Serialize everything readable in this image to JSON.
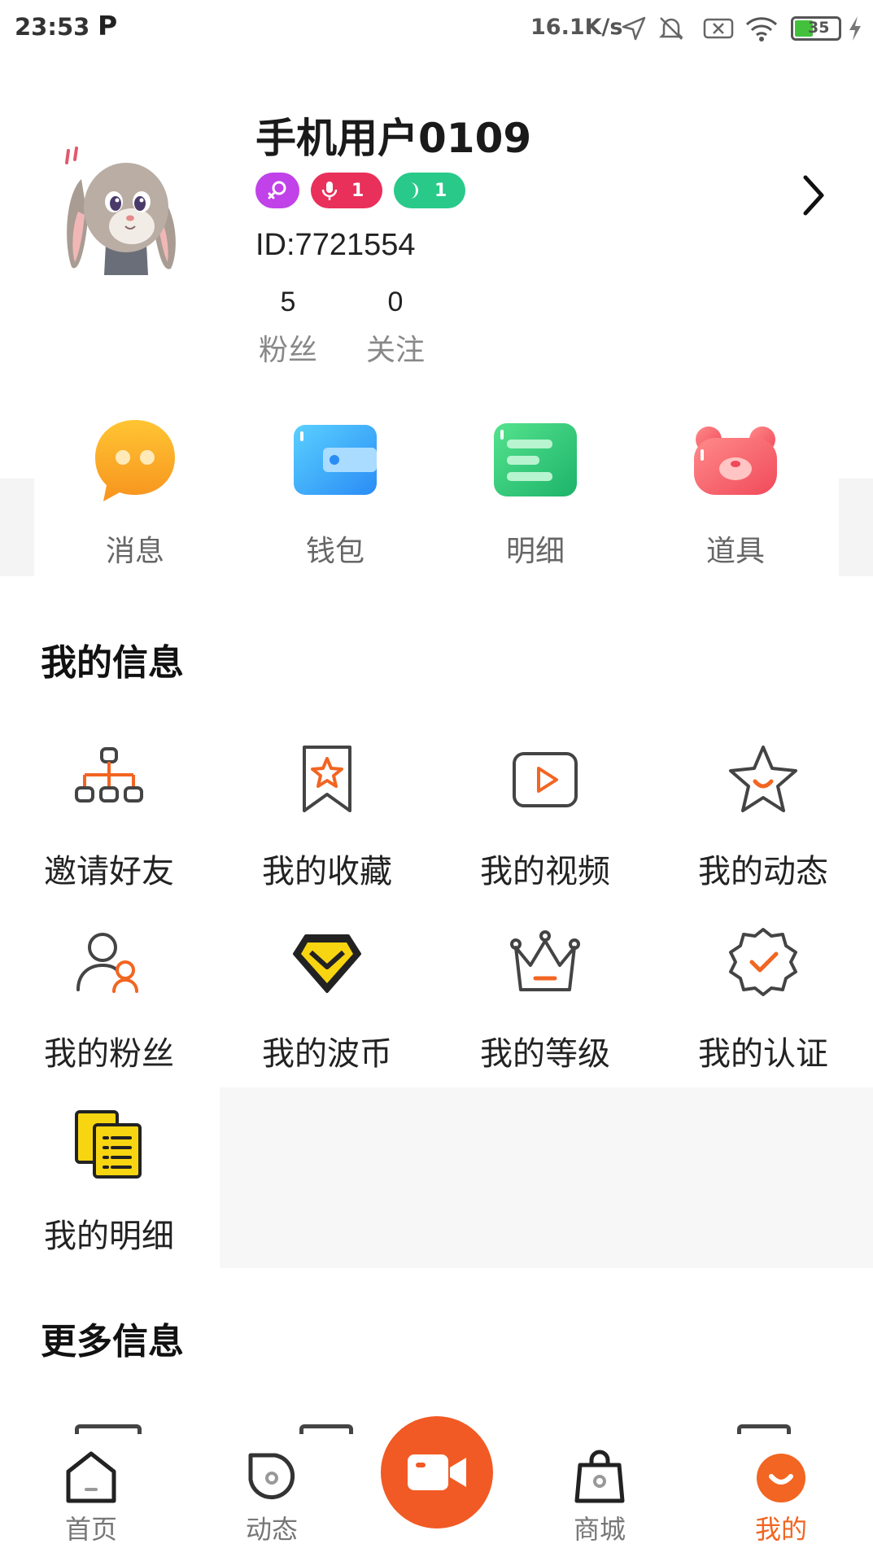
{
  "status_bar": {
    "time": "23:53",
    "app_icon": "P",
    "net_speed": "16.1K/s",
    "battery": "35",
    "icons": [
      "location-arrow-icon",
      "mute-bell-icon",
      "sim-x-icon",
      "wifi-icon",
      "battery-icon",
      "charging-icon"
    ]
  },
  "profile": {
    "username": "手机用户0109",
    "badges": [
      {
        "icon": "female-icon",
        "count": ""
      },
      {
        "icon": "mic-icon",
        "count": "1"
      },
      {
        "icon": "moon-icon",
        "count": "1"
      }
    ],
    "id_text": "ID:7721554",
    "fans_value": "5",
    "fans_label": "粉丝",
    "follow_value": "0",
    "follow_label": "关注"
  },
  "quick_actions": [
    {
      "label": "消息",
      "icon": "chat-bubble-icon"
    },
    {
      "label": "钱包",
      "icon": "wallet-icon"
    },
    {
      "label": "明细",
      "icon": "details-icon"
    },
    {
      "label": "道具",
      "icon": "bear-icon"
    }
  ],
  "my_info": {
    "title": "我的信息",
    "items": [
      {
        "label": "邀请好友",
        "icon": "invite-tree-icon"
      },
      {
        "label": "我的收藏",
        "icon": "bookmark-star-icon"
      },
      {
        "label": "我的视频",
        "icon": "video-play-icon"
      },
      {
        "label": "我的动态",
        "icon": "star-icon"
      },
      {
        "label": "我的粉丝",
        "icon": "fans-icon"
      },
      {
        "label": "我的波币",
        "icon": "diamond-icon"
      },
      {
        "label": "我的等级",
        "icon": "crown-icon"
      },
      {
        "label": "我的认证",
        "icon": "badge-check-icon"
      },
      {
        "label": "我的明细",
        "icon": "document-list-icon"
      }
    ]
  },
  "more_info": {
    "title": "更多信息"
  },
  "tab_bar": {
    "tabs": [
      {
        "label": "首页",
        "icon": "home-icon",
        "active": false
      },
      {
        "label": "动态",
        "icon": "feed-icon",
        "active": false
      },
      {
        "label": "商城",
        "icon": "shop-bag-icon",
        "active": false
      },
      {
        "label": "我的",
        "icon": "me-icon",
        "active": true
      }
    ],
    "center_icon": "video-camera-icon"
  },
  "colors": {
    "accent": "#f26522",
    "record": "#f15a24",
    "icon_gray": "#444444"
  }
}
